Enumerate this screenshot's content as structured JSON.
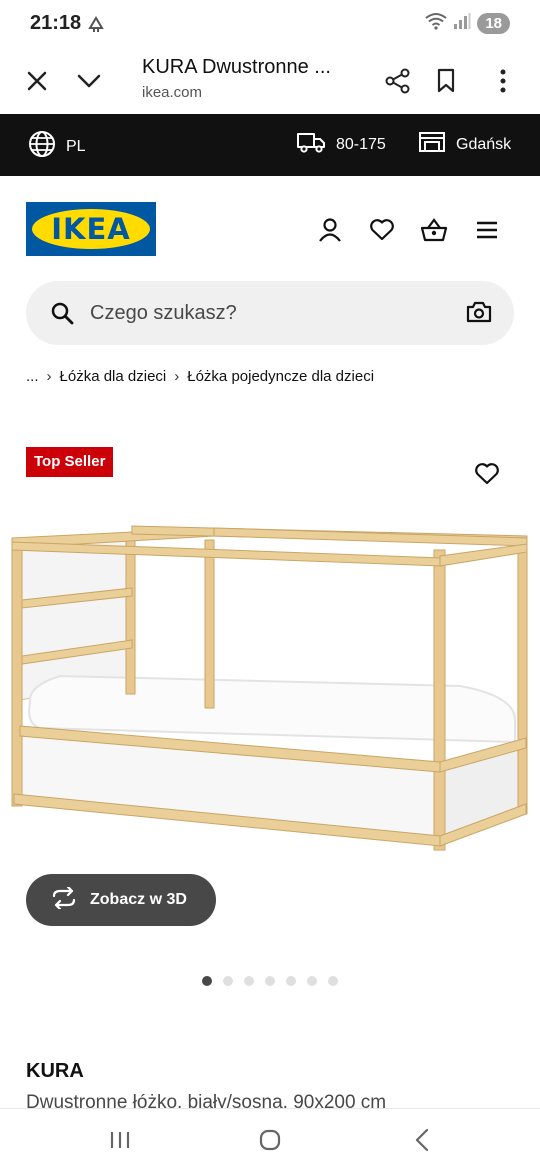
{
  "status": {
    "time": "21:18",
    "battery": "18"
  },
  "browser": {
    "tab_title": "KURA Dwustronne ...",
    "url": "ikea.com"
  },
  "info_strip": {
    "language": "PL",
    "postcode": "80-175",
    "store": "Gdańsk"
  },
  "header": {
    "logo_text": "IKEA",
    "brand_blue": "#0058a3",
    "brand_yellow": "#ffdb00"
  },
  "search": {
    "placeholder": "Czego szukasz?"
  },
  "breadcrumb": {
    "ellipsis": "...",
    "items": [
      "Łóżka dla dzieci",
      "Łóżka pojedyncze dla dzieci"
    ]
  },
  "product": {
    "badge": "Top Seller",
    "badge_color": "#cc0008",
    "view3d_label": "Zobacz w 3D",
    "name": "KURA",
    "description": "Dwustronne łóżko, biały/sosna, 90x200 cm",
    "image_count": 7,
    "active_image": 1
  }
}
